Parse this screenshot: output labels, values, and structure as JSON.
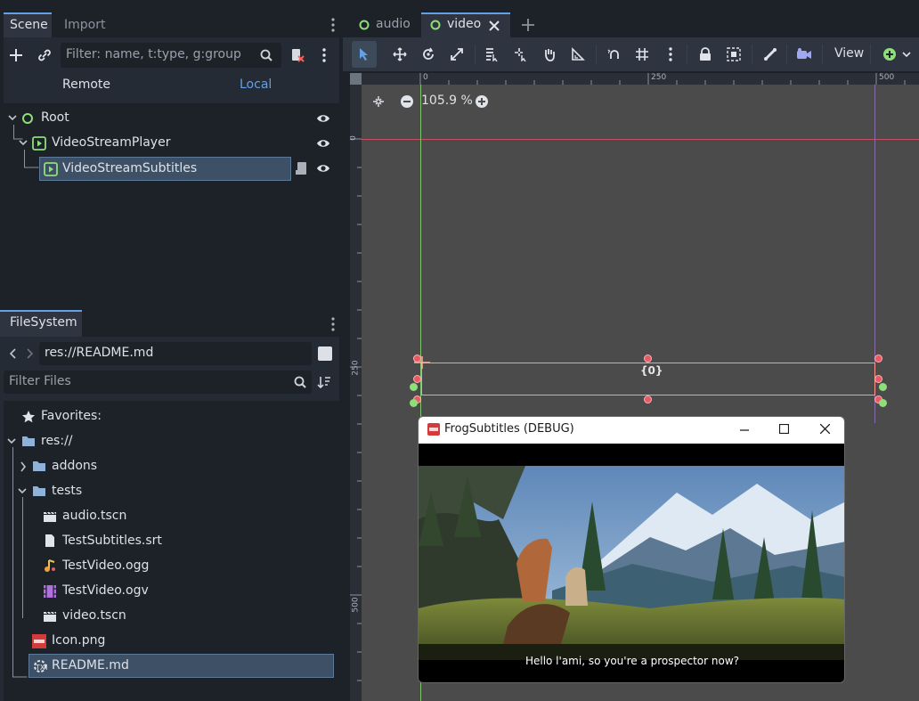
{
  "scene_panel": {
    "tabs": [
      "Scene",
      "Import"
    ],
    "filter_placeholder": "Filter: name, t:type, g:group",
    "remote_label": "Remote",
    "local_label": "Local",
    "tree": [
      {
        "label": "Root",
        "icon": "node-icon"
      },
      {
        "label": "VideoStreamPlayer",
        "icon": "video-player-icon"
      },
      {
        "label": "VideoStreamSubtitles",
        "icon": "video-player-icon",
        "selected": true
      }
    ]
  },
  "filesystem": {
    "tab": "FileSystem",
    "path": "res://README.md",
    "filter_placeholder": "Filter Files",
    "items": [
      {
        "label": "Favorites:",
        "icon": "star-icon"
      },
      {
        "label": "res://",
        "icon": "folder-icon"
      },
      {
        "label": "addons",
        "icon": "folder-icon"
      },
      {
        "label": "tests",
        "icon": "folder-icon"
      },
      {
        "label": "audio.tscn",
        "icon": "scene-file-icon"
      },
      {
        "label": "TestSubtitles.srt",
        "icon": "text-file-icon"
      },
      {
        "label": "TestVideo.ogg",
        "icon": "audio-file-icon"
      },
      {
        "label": "TestVideo.ogv",
        "icon": "video-file-icon"
      },
      {
        "label": "video.tscn",
        "icon": "scene-file-icon"
      },
      {
        "label": "Icon.png",
        "icon": "image-file-icon"
      },
      {
        "label": "README.md",
        "icon": "markdown-file-icon",
        "selected": true
      }
    ]
  },
  "editor_tabs": [
    {
      "label": "audio",
      "active": false
    },
    {
      "label": "video",
      "active": true
    }
  ],
  "toolbar": {
    "view_label": "View"
  },
  "viewport": {
    "zoom": "105.9 %",
    "ruler_h": [
      "0",
      "250",
      "500"
    ],
    "ruler_v": [
      "0",
      "250",
      "500"
    ],
    "label_text": "{0}"
  },
  "debug_window": {
    "title": "FrogSubtitles (DEBUG)",
    "subtitle": "Hello l'ami, so you're a prospector now?"
  },
  "colors": {
    "accent": "#62a0e8",
    "panel": "#252b34",
    "base": "#1d2229",
    "selection": "#3d5066",
    "green": "#8ede7a",
    "handle_red": "#e85a64"
  }
}
